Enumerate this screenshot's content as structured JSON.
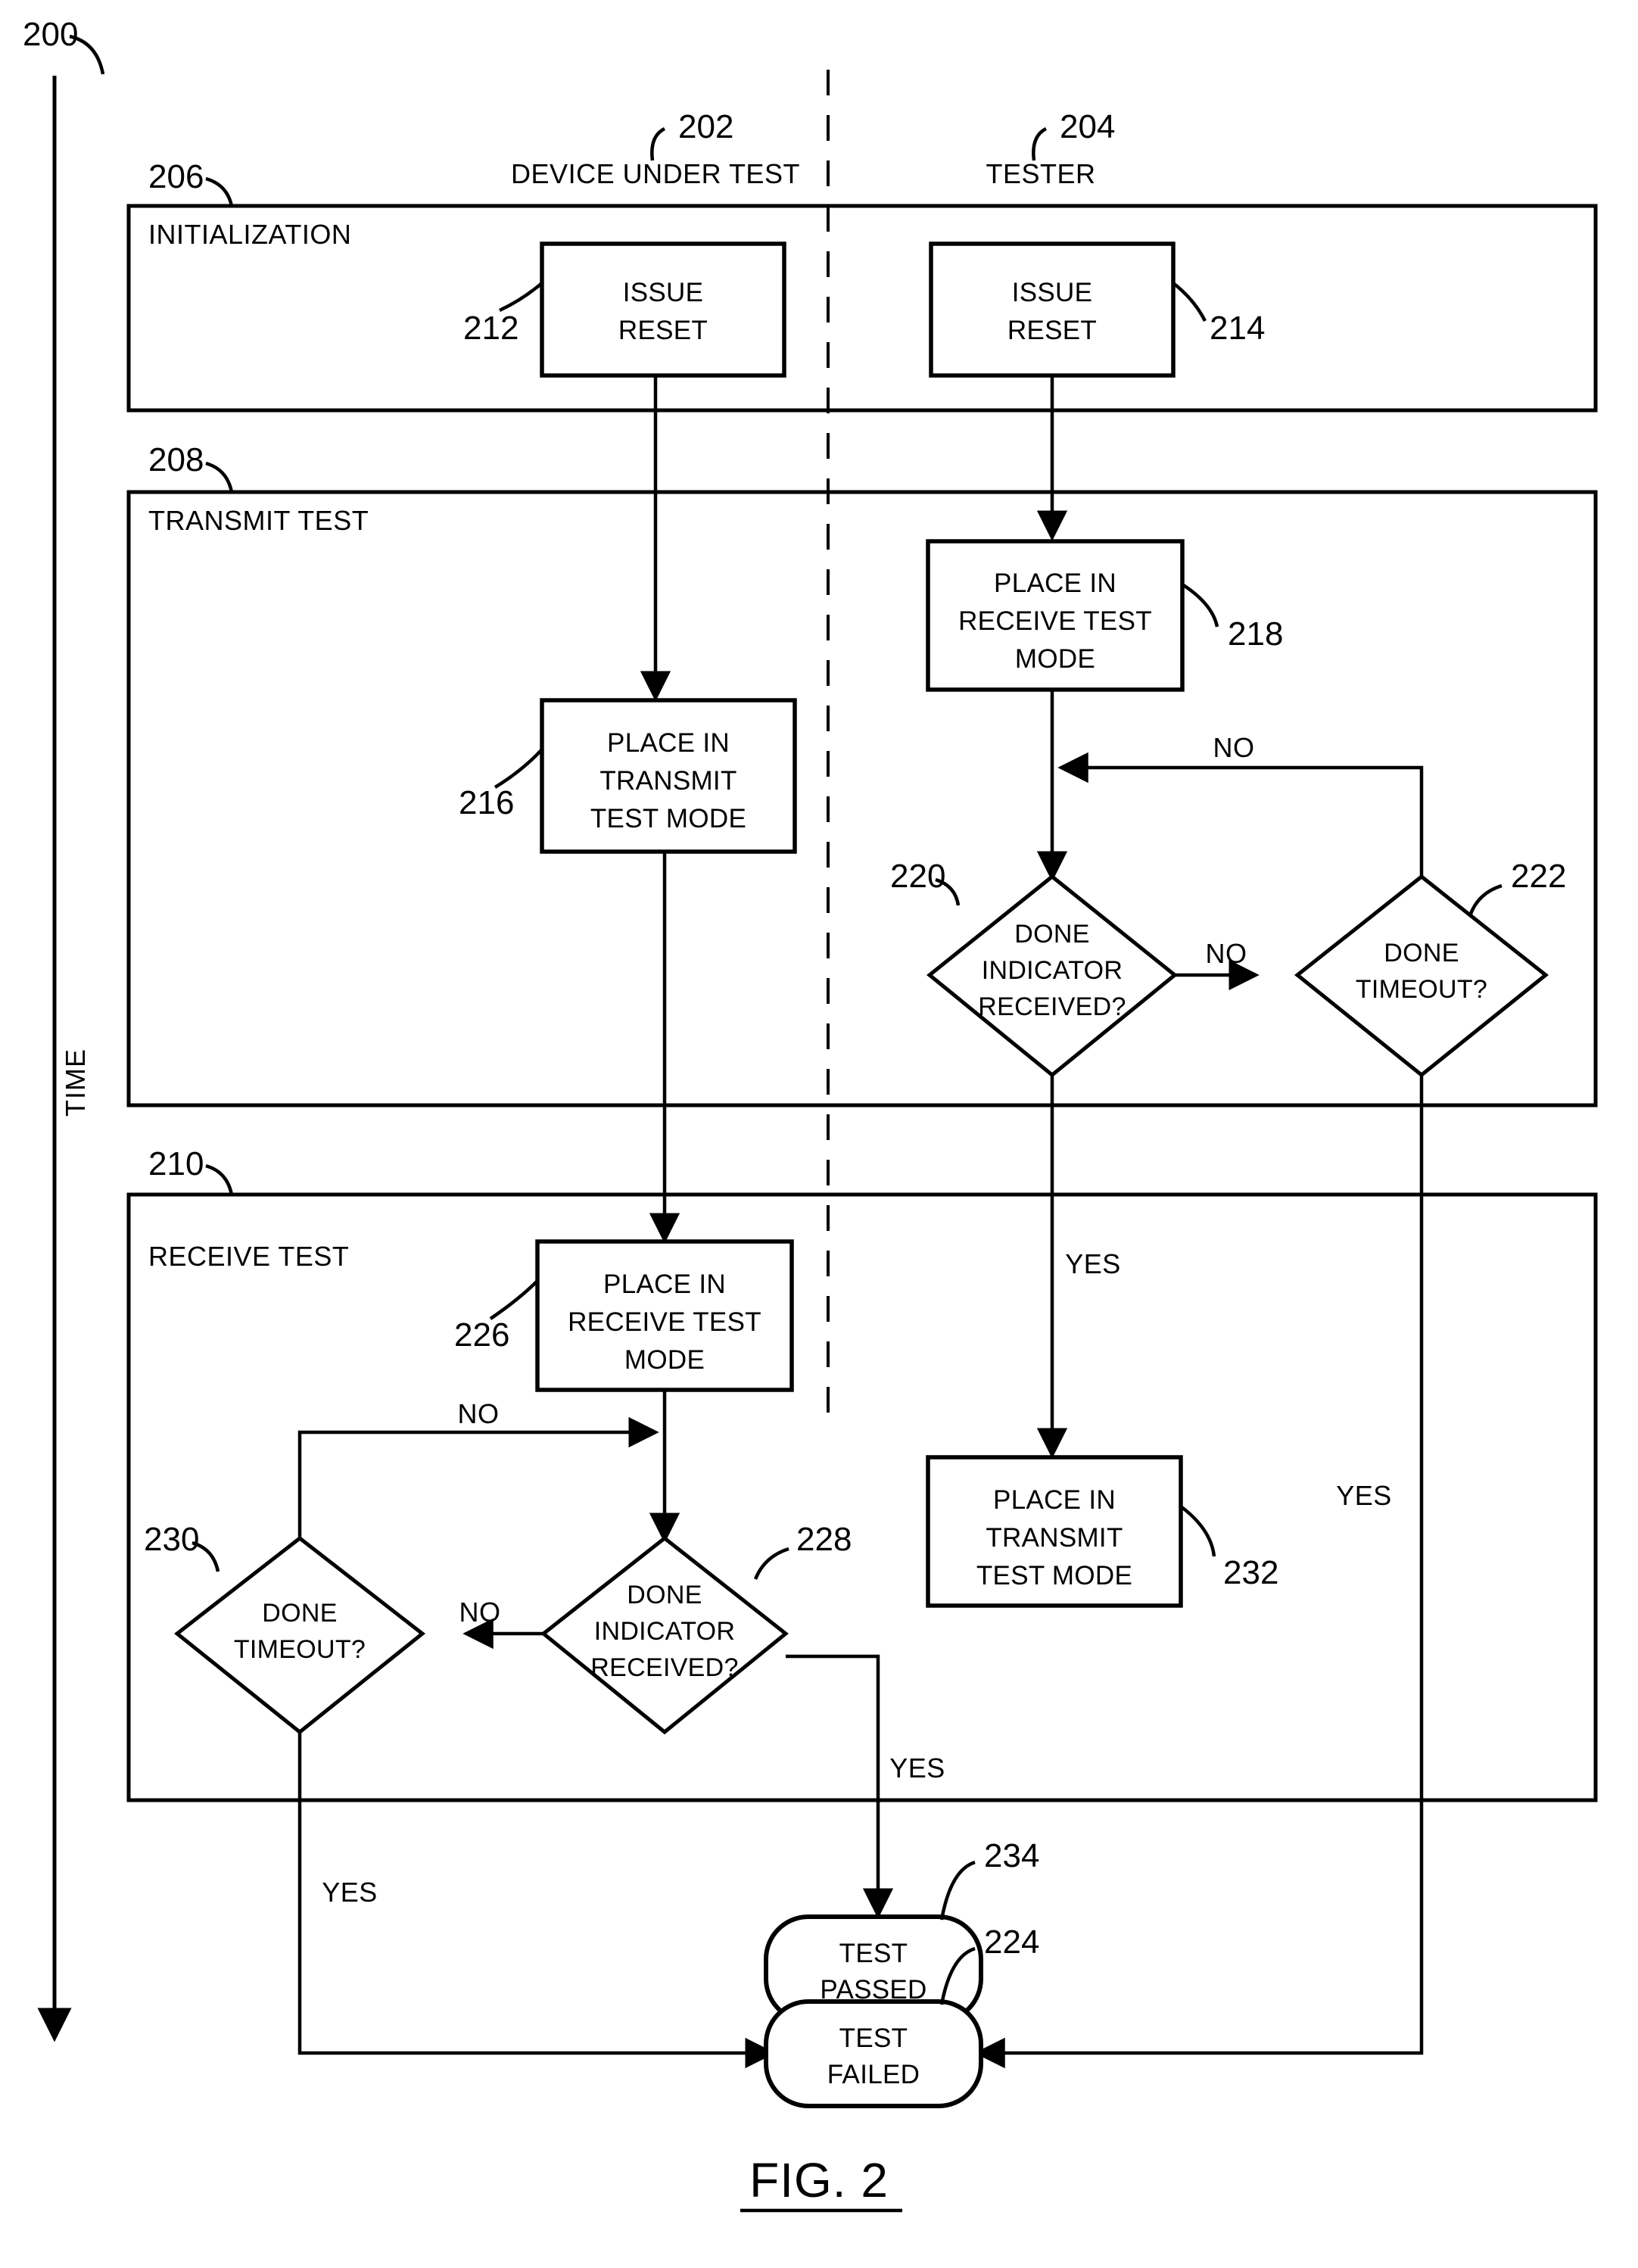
{
  "figure": {
    "caption": "FIG. 2",
    "diagram_ref": "200",
    "time_axis_label": "TIME"
  },
  "lanes": [
    {
      "label": "DEVICE UNDER TEST",
      "ref": "202"
    },
    {
      "label": "TESTER",
      "ref": "204"
    }
  ],
  "phases": [
    {
      "label": "INITIALIZATION",
      "ref": "206"
    },
    {
      "label": "TRANSMIT TEST",
      "ref": "208"
    },
    {
      "label": "RECEIVE TEST",
      "ref": "210"
    }
  ],
  "nodes": {
    "n212": {
      "ref": "212",
      "lines": [
        "ISSUE",
        "RESET"
      ],
      "shape": "process",
      "lane": "DEVICE UNDER TEST",
      "phase": "INITIALIZATION"
    },
    "n214": {
      "ref": "214",
      "lines": [
        "ISSUE",
        "RESET"
      ],
      "shape": "process",
      "lane": "TESTER",
      "phase": "INITIALIZATION"
    },
    "n216": {
      "ref": "216",
      "lines": [
        "PLACE IN",
        "TRANSMIT",
        "TEST MODE"
      ],
      "shape": "process",
      "lane": "DEVICE UNDER TEST",
      "phase": "TRANSMIT TEST"
    },
    "n218": {
      "ref": "218",
      "lines": [
        "PLACE IN",
        "RECEIVE TEST",
        "MODE"
      ],
      "shape": "process",
      "lane": "TESTER",
      "phase": "TRANSMIT TEST"
    },
    "n220": {
      "ref": "220",
      "lines": [
        "DONE",
        "INDICATOR",
        "RECEIVED?"
      ],
      "shape": "decision",
      "lane": "TESTER",
      "phase": "TRANSMIT TEST"
    },
    "n222": {
      "ref": "222",
      "lines": [
        "DONE",
        "TIMEOUT?"
      ],
      "shape": "decision",
      "lane": "TESTER",
      "phase": "TRANSMIT TEST"
    },
    "n226": {
      "ref": "226",
      "lines": [
        "PLACE IN",
        "RECEIVE TEST",
        "MODE"
      ],
      "shape": "process",
      "lane": "DEVICE UNDER TEST",
      "phase": "RECEIVE TEST"
    },
    "n228": {
      "ref": "228",
      "lines": [
        "DONE",
        "INDICATOR",
        "RECEIVED?"
      ],
      "shape": "decision",
      "lane": "DEVICE UNDER TEST",
      "phase": "RECEIVE TEST"
    },
    "n230": {
      "ref": "230",
      "lines": [
        "DONE",
        "TIMEOUT?"
      ],
      "shape": "decision",
      "lane": "DEVICE UNDER TEST",
      "phase": "RECEIVE TEST"
    },
    "n232": {
      "ref": "232",
      "lines": [
        "PLACE IN",
        "TRANSMIT",
        "TEST MODE"
      ],
      "shape": "process",
      "lane": "TESTER",
      "phase": "RECEIVE TEST"
    },
    "n234": {
      "ref": "234",
      "lines": [
        "TEST",
        "PASSED"
      ],
      "shape": "terminal"
    },
    "n224": {
      "ref": "224",
      "lines": [
        "TEST",
        "FAILED"
      ],
      "shape": "terminal"
    }
  },
  "branch_labels": {
    "b220_no": "NO",
    "b222_no": "NO",
    "b222_yes": "YES",
    "b228_no": "NO",
    "b228_yes": "YES",
    "b230_no": "NO",
    "b230_yes": "YES",
    "b220_yes": "YES"
  },
  "colors": {
    "stroke": "#000000",
    "background": "#ffffff"
  }
}
